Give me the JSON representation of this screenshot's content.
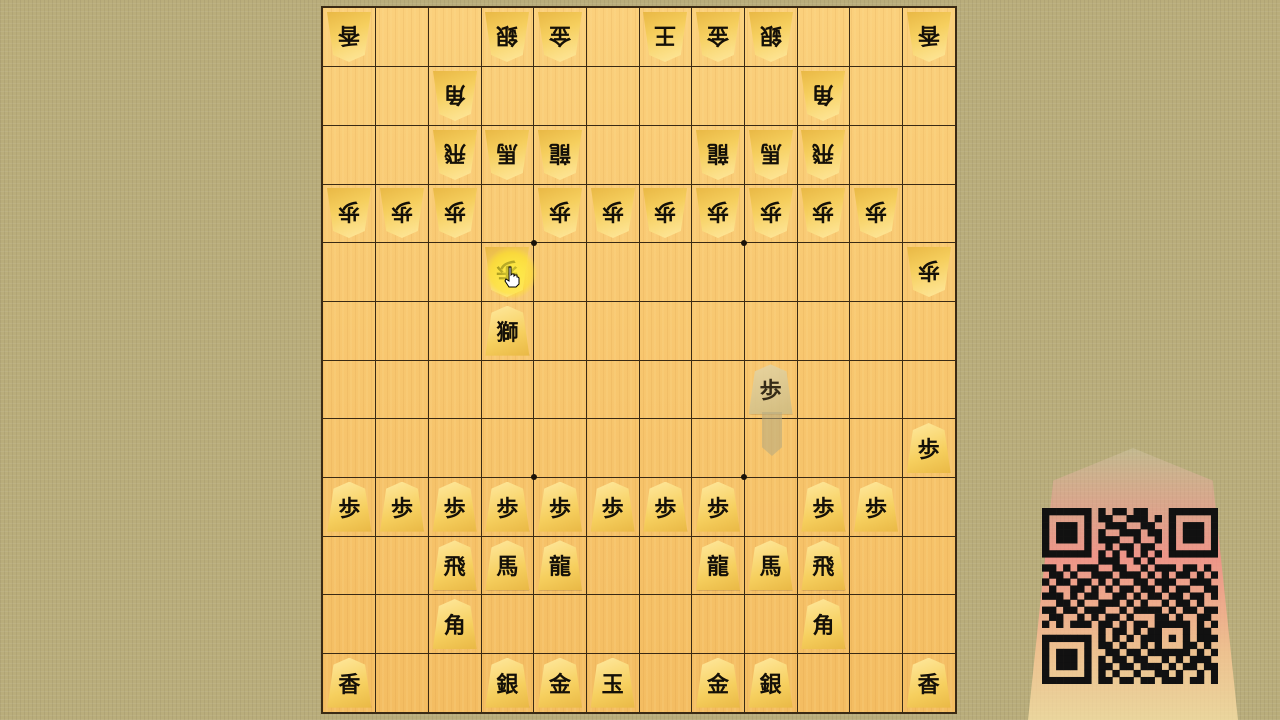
{
  "board": {
    "pieces": [
      {
        "k": "香",
        "c": 0,
        "r": 0,
        "o": "gote"
      },
      {
        "k": "銀",
        "c": 3,
        "r": 0,
        "o": "gote"
      },
      {
        "k": "金",
        "c": 4,
        "r": 0,
        "o": "gote"
      },
      {
        "k": "王",
        "c": 6,
        "r": 0,
        "o": "gote"
      },
      {
        "k": "金",
        "c": 7,
        "r": 0,
        "o": "gote"
      },
      {
        "k": "銀",
        "c": 8,
        "r": 0,
        "o": "gote"
      },
      {
        "k": "香",
        "c": 11,
        "r": 0,
        "o": "gote"
      },
      {
        "k": "角",
        "c": 2,
        "r": 1,
        "o": "gote"
      },
      {
        "k": "角",
        "c": 9,
        "r": 1,
        "o": "gote"
      },
      {
        "k": "飛",
        "c": 2,
        "r": 2,
        "o": "gote"
      },
      {
        "k": "馬",
        "c": 3,
        "r": 2,
        "o": "gote"
      },
      {
        "k": "龍",
        "c": 4,
        "r": 2,
        "o": "gote"
      },
      {
        "k": "龍",
        "c": 7,
        "r": 2,
        "o": "gote"
      },
      {
        "k": "馬",
        "c": 8,
        "r": 2,
        "o": "gote"
      },
      {
        "k": "飛",
        "c": 9,
        "r": 2,
        "o": "gote"
      },
      {
        "k": "歩",
        "c": 0,
        "r": 3,
        "o": "gote"
      },
      {
        "k": "歩",
        "c": 1,
        "r": 3,
        "o": "gote"
      },
      {
        "k": "歩",
        "c": 2,
        "r": 3,
        "o": "gote"
      },
      {
        "k": "歩",
        "c": 4,
        "r": 3,
        "o": "gote"
      },
      {
        "k": "歩",
        "c": 5,
        "r": 3,
        "o": "gote"
      },
      {
        "k": "歩",
        "c": 6,
        "r": 3,
        "o": "gote"
      },
      {
        "k": "歩",
        "c": 7,
        "r": 3,
        "o": "gote"
      },
      {
        "k": "歩",
        "c": 8,
        "r": 3,
        "o": "gote"
      },
      {
        "k": "歩",
        "c": 9,
        "r": 3,
        "o": "gote"
      },
      {
        "k": "歩",
        "c": 10,
        "r": 3,
        "o": "gote"
      },
      {
        "k": "歩",
        "c": 3,
        "r": 4,
        "o": "gote"
      },
      {
        "k": "歩",
        "c": 11,
        "r": 4,
        "o": "gote"
      },
      {
        "k": "獅",
        "c": 3,
        "r": 5,
        "o": "sente"
      },
      {
        "k": "歩",
        "c": 8,
        "r": 6,
        "o": "ghost"
      },
      {
        "k": "歩",
        "c": 11,
        "r": 7,
        "o": "sente"
      },
      {
        "k": "歩",
        "c": 0,
        "r": 8,
        "o": "sente"
      },
      {
        "k": "歩",
        "c": 1,
        "r": 8,
        "o": "sente"
      },
      {
        "k": "歩",
        "c": 2,
        "r": 8,
        "o": "sente"
      },
      {
        "k": "歩",
        "c": 3,
        "r": 8,
        "o": "sente"
      },
      {
        "k": "歩",
        "c": 4,
        "r": 8,
        "o": "sente"
      },
      {
        "k": "歩",
        "c": 5,
        "r": 8,
        "o": "sente"
      },
      {
        "k": "歩",
        "c": 6,
        "r": 8,
        "o": "sente"
      },
      {
        "k": "歩",
        "c": 7,
        "r": 8,
        "o": "sente"
      },
      {
        "k": "歩",
        "c": 9,
        "r": 8,
        "o": "sente"
      },
      {
        "k": "歩",
        "c": 10,
        "r": 8,
        "o": "sente"
      },
      {
        "k": "飛",
        "c": 2,
        "r": 9,
        "o": "sente"
      },
      {
        "k": "馬",
        "c": 3,
        "r": 9,
        "o": "sente"
      },
      {
        "k": "龍",
        "c": 4,
        "r": 9,
        "o": "sente"
      },
      {
        "k": "龍",
        "c": 7,
        "r": 9,
        "o": "sente"
      },
      {
        "k": "馬",
        "c": 8,
        "r": 9,
        "o": "sente"
      },
      {
        "k": "飛",
        "c": 9,
        "r": 9,
        "o": "sente"
      },
      {
        "k": "角",
        "c": 2,
        "r": 10,
        "o": "sente"
      },
      {
        "k": "角",
        "c": 9,
        "r": 10,
        "o": "sente"
      },
      {
        "k": "香",
        "c": 0,
        "r": 11,
        "o": "sente"
      },
      {
        "k": "銀",
        "c": 3,
        "r": 11,
        "o": "sente"
      },
      {
        "k": "金",
        "c": 4,
        "r": 11,
        "o": "sente"
      },
      {
        "k": "玉",
        "c": 5,
        "r": 11,
        "o": "sente"
      },
      {
        "k": "金",
        "c": 7,
        "r": 11,
        "o": "sente"
      },
      {
        "k": "銀",
        "c": 8,
        "r": 11,
        "o": "sente"
      },
      {
        "k": "香",
        "c": 11,
        "r": 11,
        "o": "sente"
      }
    ]
  },
  "qr": {
    "rows": [
      "1111111010110110001111111",
      "1000001011001110101000001",
      "1011101001110011001011101",
      "1011101010011101101011101",
      "1011101011100100101011101",
      "1000001001011011001000001",
      "1111111010101010101111111",
      "0000000011100101000000000",
      "1101011100110010111011010",
      "0110100111011101010110101",
      "1011011010100110111001110",
      "0100110101011011010110011",
      "1110101100110101101101101",
      "0011010011101010010110100",
      "1101101110010111101011011",
      "0110010101101000110100110",
      "1010111011010110111110101",
      "0000000010110101100010110",
      "1111111010101011101010111",
      "1000001011010010100011010",
      "1011101001101101111110101",
      "1011101010110110010101110",
      "1011101011011011101011011",
      "1000001010100100110100101",
      "1111111011011011011101101"
    ]
  }
}
